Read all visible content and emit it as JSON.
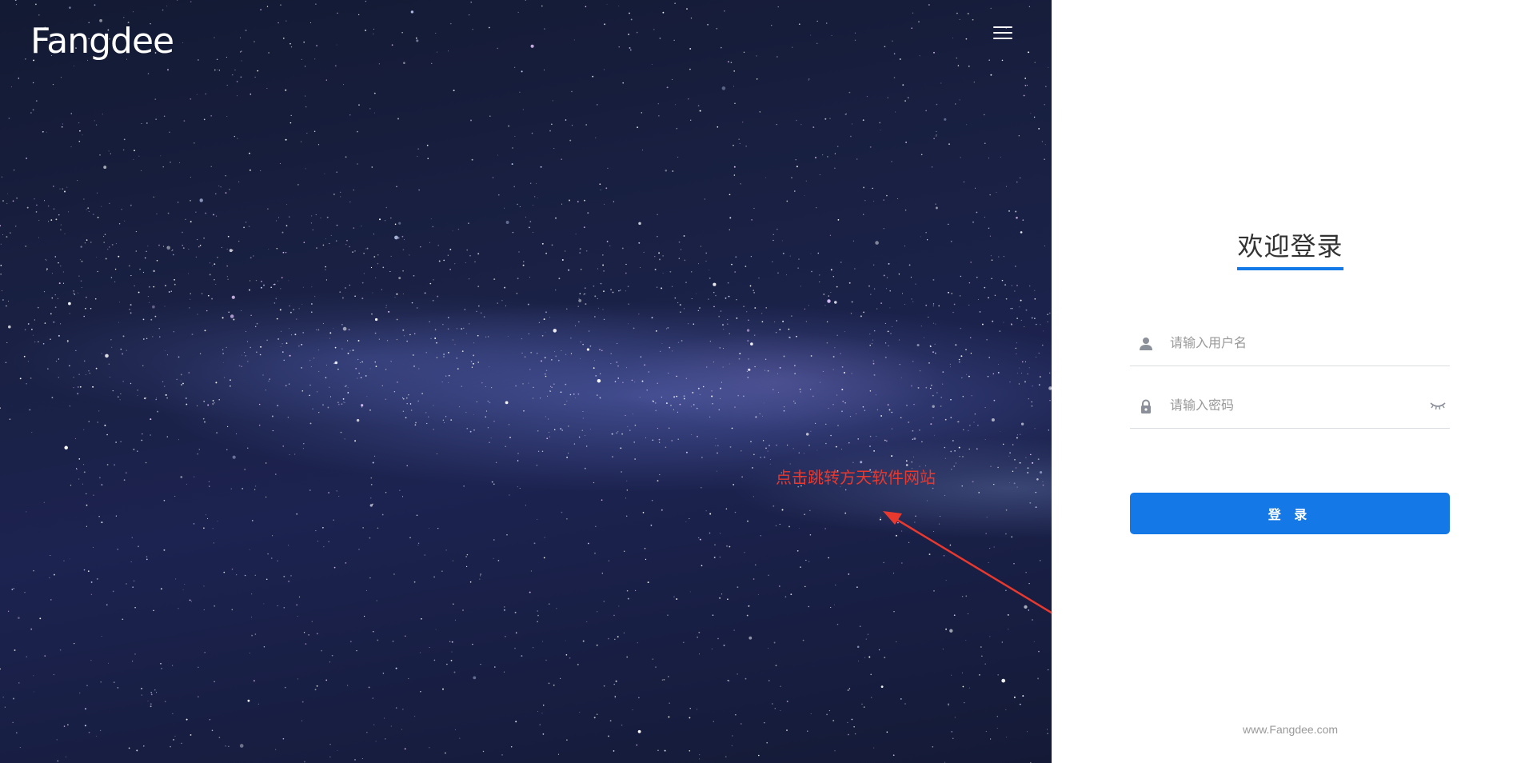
{
  "brand": {
    "logo_text": "Fangdee"
  },
  "header": {
    "menu_icon": "hamburger-menu-icon"
  },
  "annotation": {
    "text": "点击跳转方天软件网站",
    "color": "#e8392f"
  },
  "login": {
    "title": "欢迎登录",
    "username": {
      "icon": "user-icon",
      "placeholder": "请输入用户名",
      "value": ""
    },
    "password": {
      "icon": "lock-icon",
      "placeholder": "请输入密码",
      "value": "",
      "toggle_icon": "eye-closed-icon"
    },
    "submit_label": "登 录"
  },
  "footer": {
    "link_text": "www.Fangdee.com"
  },
  "colors": {
    "accent": "#1478e6",
    "hero_background": "#1a2145",
    "annotation": "#e8392f"
  }
}
